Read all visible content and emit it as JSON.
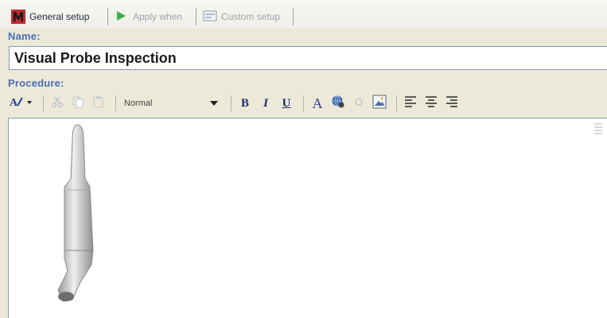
{
  "tabs": [
    {
      "label": "General setup",
      "icon": "m-logo-icon",
      "active": true
    },
    {
      "label": "Apply when",
      "icon": "play-arrow-icon",
      "active": false
    },
    {
      "label": "Custom setup",
      "icon": "form-icon",
      "active": false
    }
  ],
  "name_field": {
    "label": "Name:",
    "value": "Visual Probe Inspection"
  },
  "procedure": {
    "label": "Procedure:"
  },
  "toolbar": {
    "style_value": "Normal",
    "bold": "B",
    "italic": "I",
    "underline": "U",
    "font_color": "A"
  },
  "colors": {
    "accent": "#4a6eb4",
    "border": "#7f9db9",
    "logo_red": "#c0282e"
  }
}
